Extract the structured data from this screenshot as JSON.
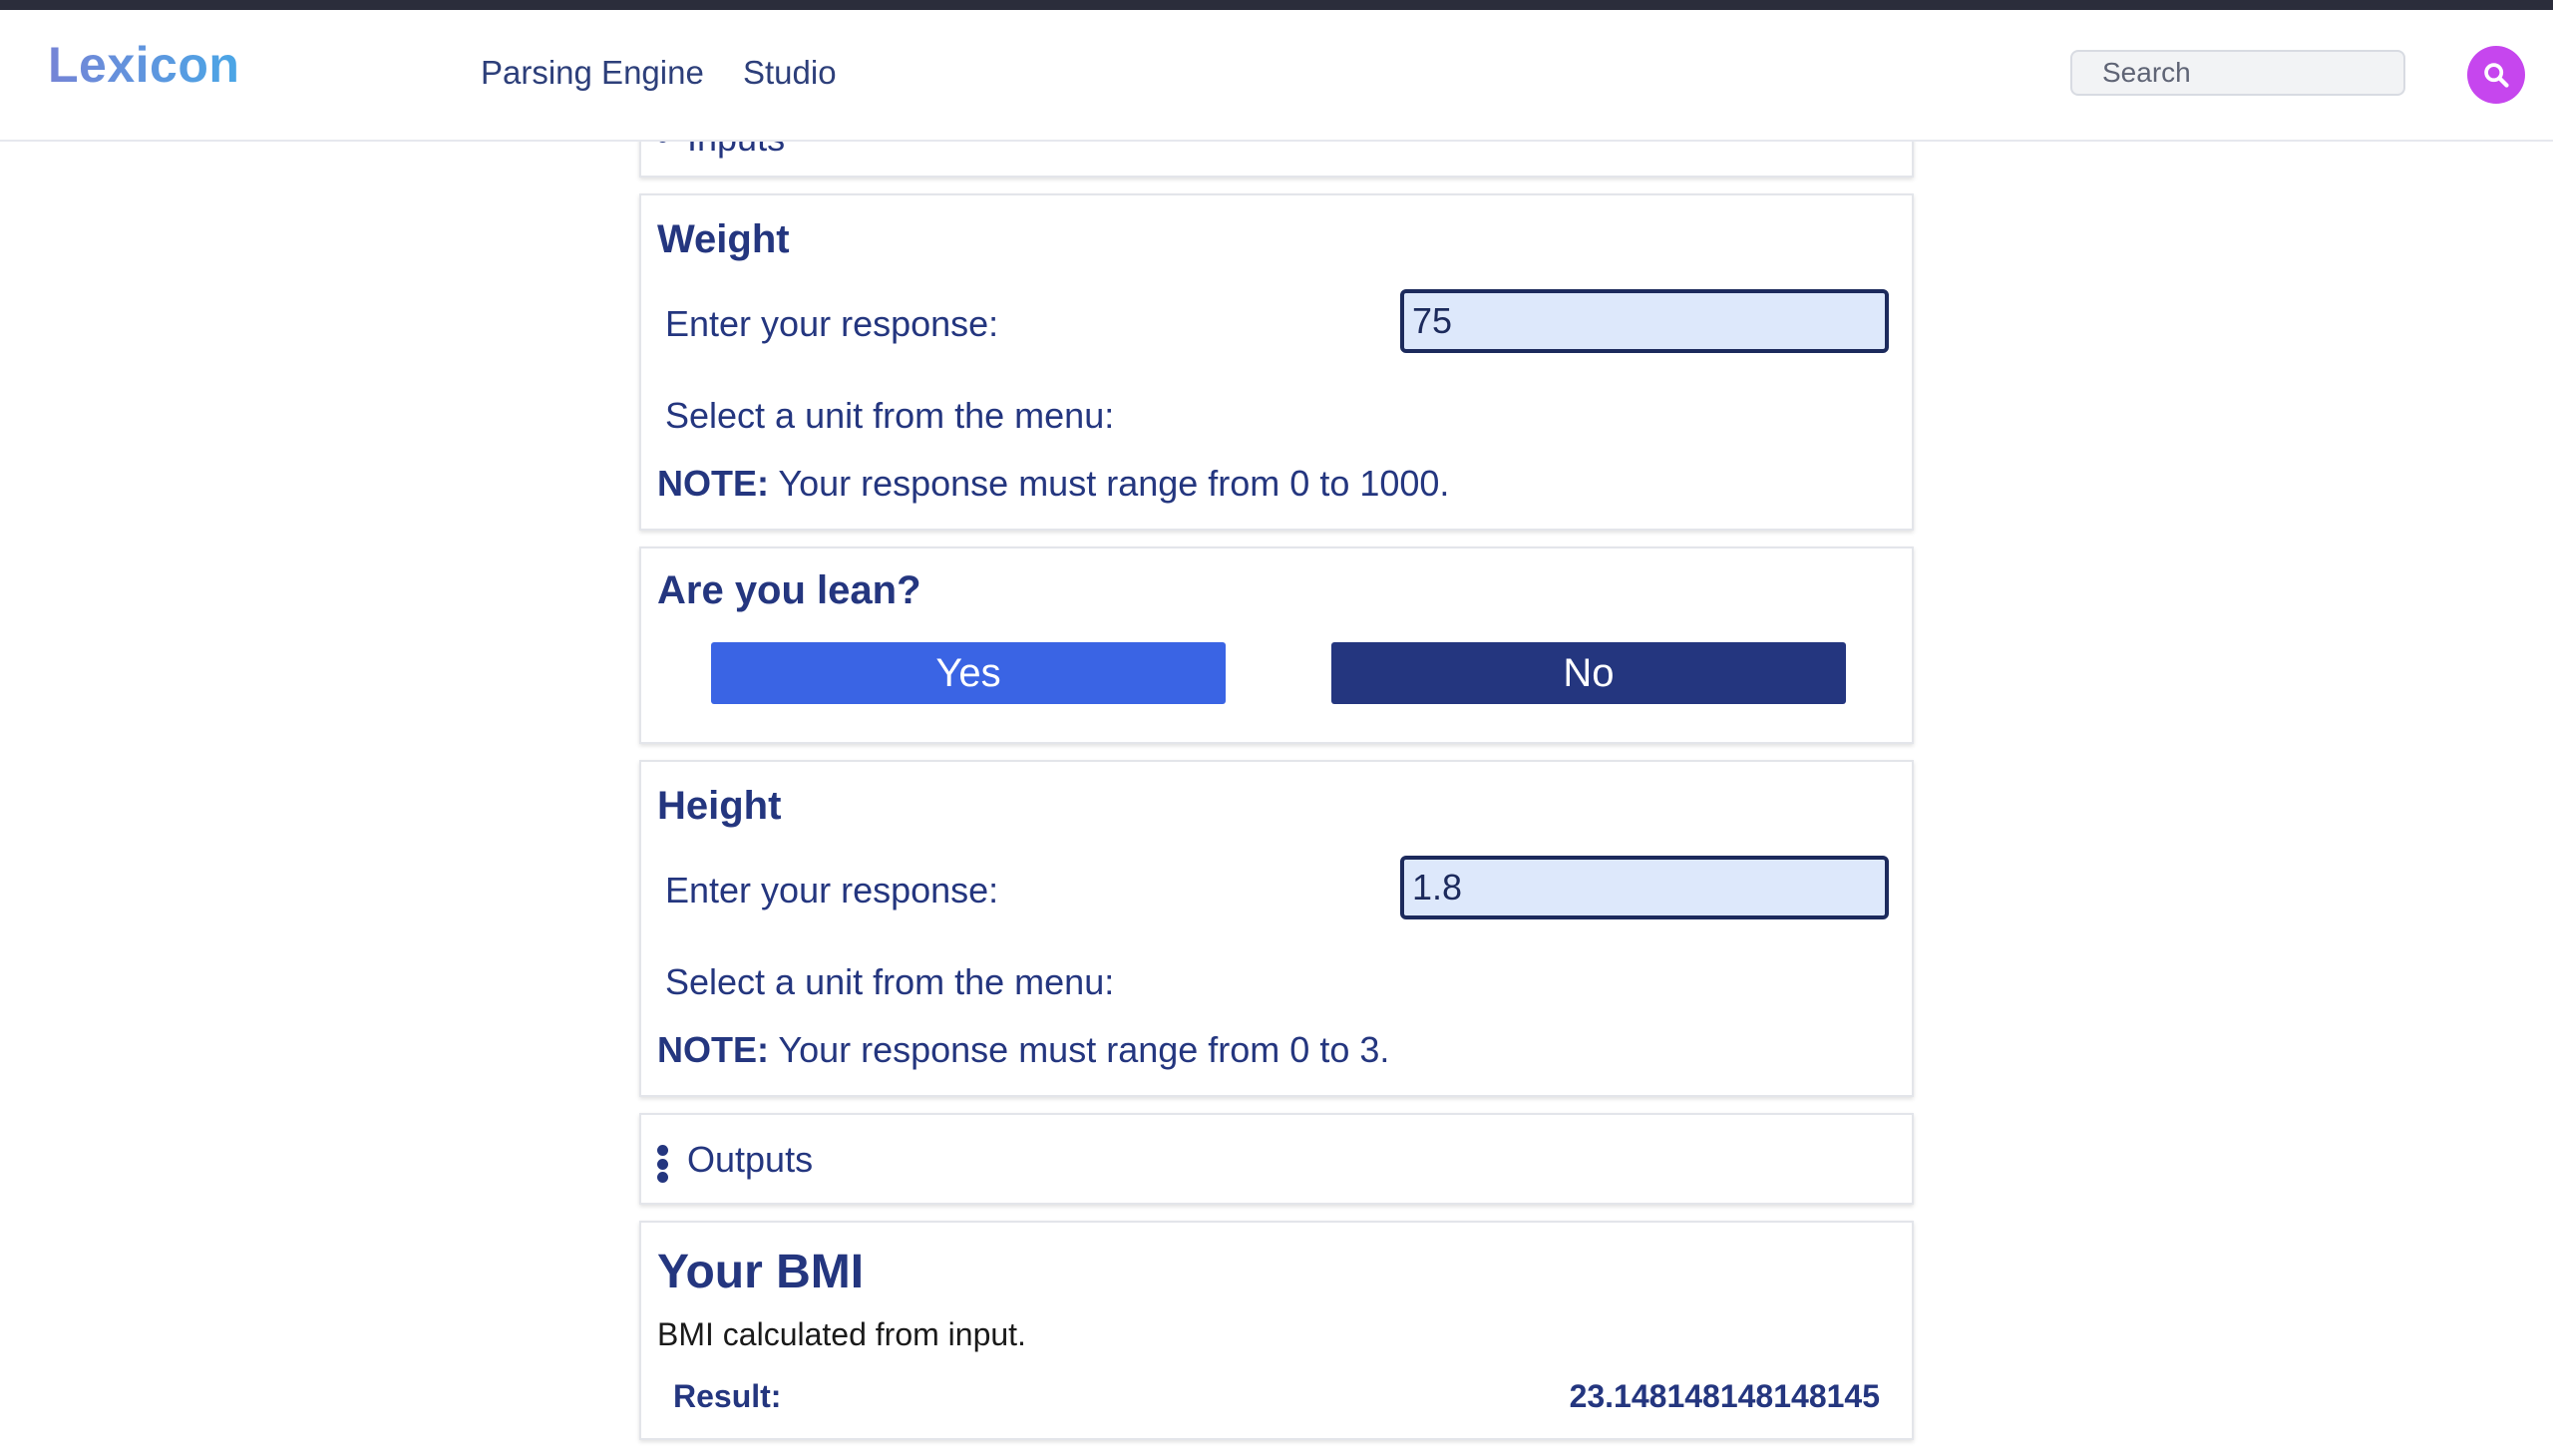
{
  "navbar": {
    "logo": "Lexicon",
    "links": [
      "Parsing Engine",
      "Studio"
    ],
    "search_placeholder": "Search"
  },
  "inputs_section": {
    "label": "Inputs"
  },
  "weight": {
    "title": "Weight",
    "response_label": "Enter your response:",
    "value": "75",
    "unit_label": "Select a unit from the menu:",
    "note_prefix": "NOTE:",
    "note_text": "Your response must range from 0 to 1000."
  },
  "lean": {
    "title": "Are you lean?",
    "yes_label": "Yes",
    "no_label": "No"
  },
  "height": {
    "title": "Height",
    "response_label": "Enter your response:",
    "value": "1.8",
    "unit_label": "Select a unit from the menu:",
    "note_prefix": "NOTE:",
    "note_text": "Your response must range from 0 to 3."
  },
  "outputs_section": {
    "label": "Outputs"
  },
  "bmi": {
    "title": "Your BMI",
    "description": "BMI calculated from input.",
    "result_label": "Result:",
    "result_value": "23.148148148148145"
  },
  "colors": {
    "accent_blue": "#3a64e4",
    "navy": "#24367f",
    "search_button": "#c646ee"
  },
  "icons": {
    "search": "search-icon",
    "kebab": "kebab-icon"
  }
}
